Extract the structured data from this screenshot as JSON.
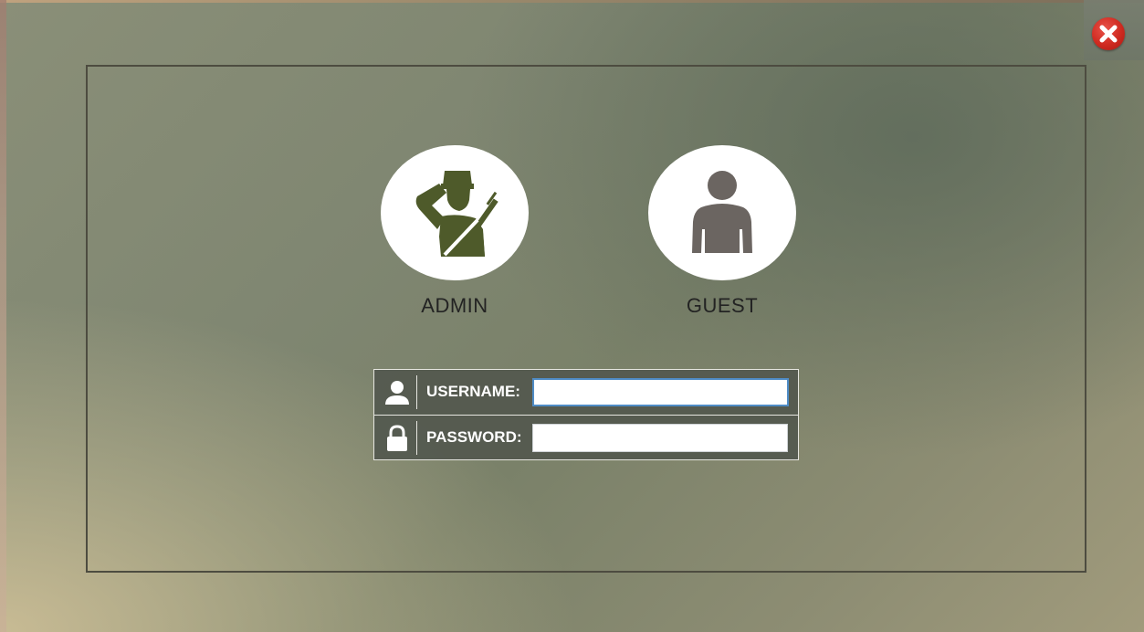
{
  "window": {
    "close_icon": "close-icon",
    "close_color": "#cf2a20"
  },
  "roles": [
    {
      "label": "ADMIN",
      "icon": "soldier-salute-icon",
      "icon_color": "#4e5a2a"
    },
    {
      "label": "GUEST",
      "icon": "person-icon",
      "icon_color": "#6b6561"
    }
  ],
  "login": {
    "username_label": "USERNAME:",
    "username_value": "",
    "username_icon": "user-icon",
    "password_label": "PASSWORD:",
    "password_value": "",
    "password_icon": "lock-icon"
  }
}
